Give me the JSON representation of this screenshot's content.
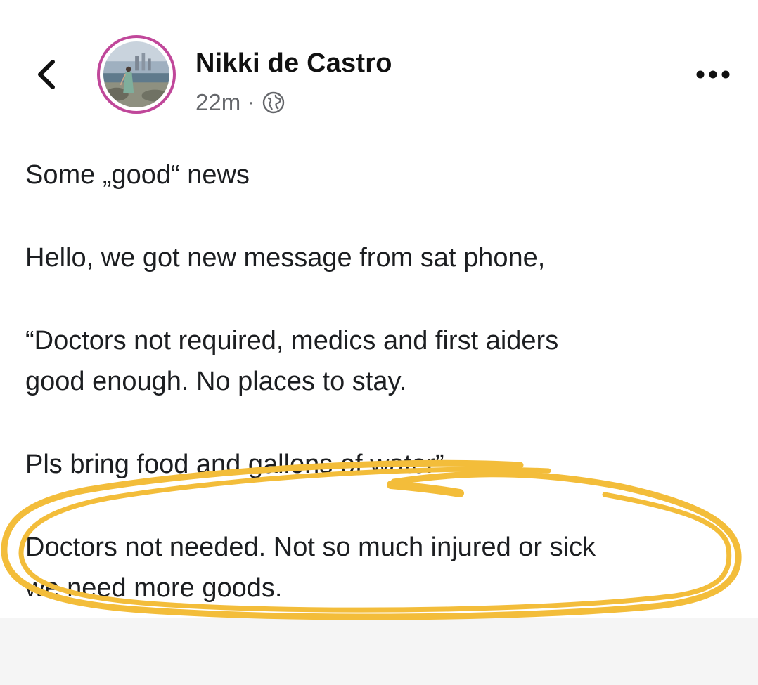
{
  "post": {
    "author": "Nikki de Castro",
    "time": "22m",
    "separator": "·",
    "privacy_icon": "globe-icon",
    "back_icon": "chevron-left-icon",
    "more_icon": "more-options-icon",
    "paragraphs": [
      "Some „good“ news",
      "Hello, we got new message from sat phone,",
      "“Doctors not required, medics and first aiders\ngood enough. No places to stay.",
      "Pls bring food and gallons of water”",
      "Doctors not needed. Not so much injured or sick\nwe need more goods."
    ]
  },
  "colors": {
    "highlight": "#f3bd3a",
    "avatar_ring": "#c0479a",
    "meta_text": "#65676b"
  }
}
